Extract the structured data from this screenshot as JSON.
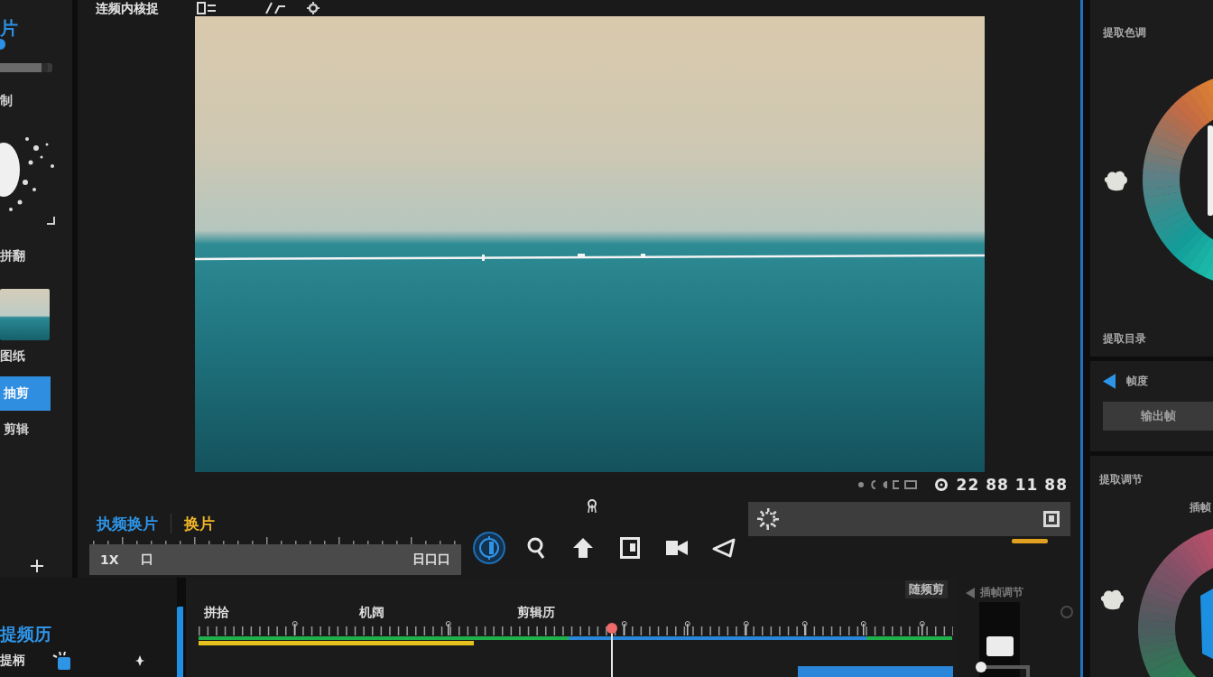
{
  "viewer": {
    "title": "连频内核捉",
    "timecode": "22 88 11 88",
    "tabs": [
      {
        "label": "执频换片",
        "selected": true
      },
      {
        "label": "换片",
        "selected": false
      }
    ],
    "scrub": {
      "speed": "1X",
      "mark": "口",
      "counter": "日口口"
    },
    "tools": [
      {
        "kind": "dial",
        "selected": true
      },
      {
        "kind": "search",
        "selected": false
      },
      {
        "kind": "upload",
        "selected": false
      },
      {
        "kind": "panel",
        "selected": false
      },
      {
        "kind": "camera",
        "selected": false
      },
      {
        "kind": "triangle",
        "selected": false
      }
    ]
  },
  "sidebar": {
    "heading": "片",
    "label": "制",
    "slider": {
      "level": 0.92
    },
    "caption": "拼翻",
    "thumbnail_caption": "图纸",
    "items": [
      {
        "label": "抽剪",
        "selected": true
      },
      {
        "label": "剪辑",
        "selected": false
      }
    ]
  },
  "timeline": {
    "heading": "提频历",
    "track_label": "提柄",
    "title": "随频剪",
    "markers": [
      "拼拾",
      "机阔",
      "剪辑历"
    ],
    "playhead": {
      "level": 0.55
    }
  },
  "mini_panel": {
    "title": "插帧调节"
  },
  "color_panel": {
    "title": "提取色调",
    "wheel_caption": "提取目录",
    "mode": "帧度",
    "button": "输出帧",
    "adjust_title": "提取调节",
    "adjust_label": "插帧"
  }
}
